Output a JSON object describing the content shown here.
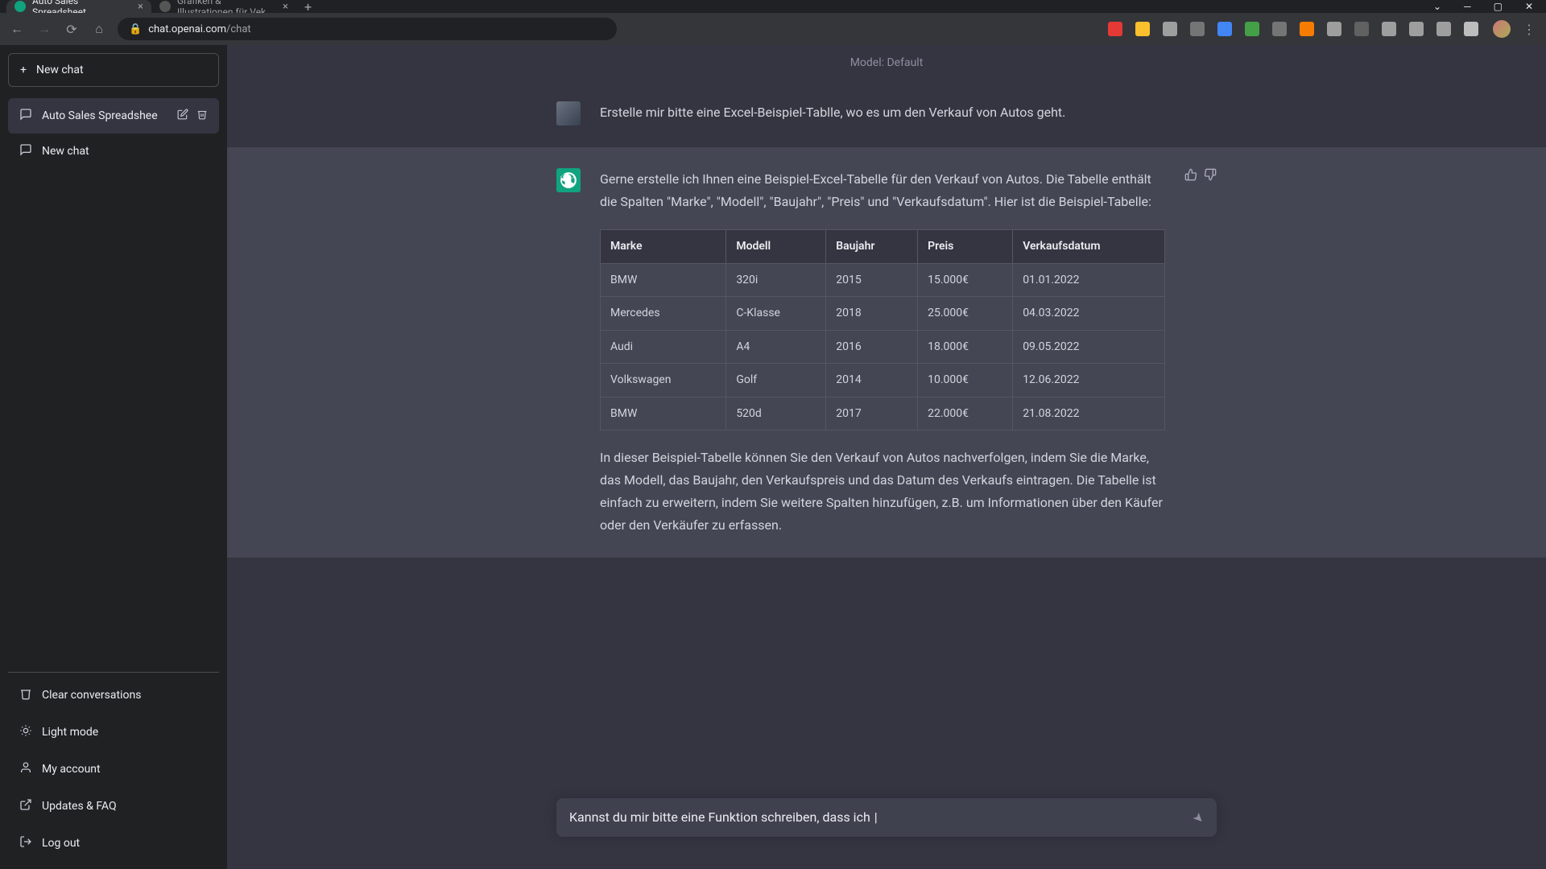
{
  "browser": {
    "tabs": [
      {
        "title": "Auto Sales Spreadsheet.",
        "active": true
      },
      {
        "title": "Grafiken & Illustrationen für Vek",
        "active": false
      }
    ],
    "url_host": "chat.openai.com",
    "url_path": "/chat",
    "ext_colors": [
      "#e53935",
      "#fbc02d",
      "#9e9e9e",
      "#757575",
      "#4285f4",
      "#43a047",
      "#757575",
      "#f57c00",
      "#9e9e9e",
      "#616161",
      "#9e9e9e",
      "#9e9e9e",
      "#9e9e9e",
      "#bdbdbd"
    ]
  },
  "sidebar": {
    "new_chat": "New chat",
    "items": [
      {
        "label": "Auto Sales Spreadshee",
        "active": true,
        "editable": true
      },
      {
        "label": "New chat",
        "active": false
      }
    ],
    "footer": {
      "clear": "Clear conversations",
      "light": "Light mode",
      "account": "My account",
      "updates": "Updates & FAQ",
      "logout": "Log out"
    }
  },
  "main": {
    "model_label": "Model: Default",
    "user_message": "Erstelle mir bitte eine Excel-Beispiel-Tablle, wo es um den Verkauf von Autos geht.",
    "assistant_intro": "Gerne erstelle ich Ihnen eine Beispiel-Excel-Tabelle für den Verkauf von Autos. Die Tabelle enthält die Spalten \"Marke\", \"Modell\", \"Baujahr\", \"Preis\" und \"Verkaufsdatum\". Hier ist die Beispiel-Tabelle:",
    "assistant_outro": "In dieser Beispiel-Tabelle können Sie den Verkauf von Autos nachverfolgen, indem Sie die Marke, das Modell, das Baujahr, den Verkaufspreis und das Datum des Verkaufs eintragen. Die Tabelle ist einfach zu erweitern, indem Sie weitere Spalten hinzufügen, z.B. um Informationen über den Käufer oder den Verkäufer zu erfassen.",
    "table": {
      "headers": [
        "Marke",
        "Modell",
        "Baujahr",
        "Preis",
        "Verkaufsdatum"
      ],
      "rows": [
        [
          "BMW",
          "320i",
          "2015",
          "15.000€",
          "01.01.2022"
        ],
        [
          "Mercedes",
          "C-Klasse",
          "2018",
          "25.000€",
          "04.03.2022"
        ],
        [
          "Audi",
          "A4",
          "2016",
          "18.000€",
          "09.05.2022"
        ],
        [
          "Volkswagen",
          "Golf",
          "2014",
          "10.000€",
          "12.06.2022"
        ],
        [
          "BMW",
          "520d",
          "2017",
          "22.000€",
          "21.08.2022"
        ]
      ]
    },
    "input_value": "Kannst du mir bitte eine Funktion schreiben, dass ich "
  }
}
